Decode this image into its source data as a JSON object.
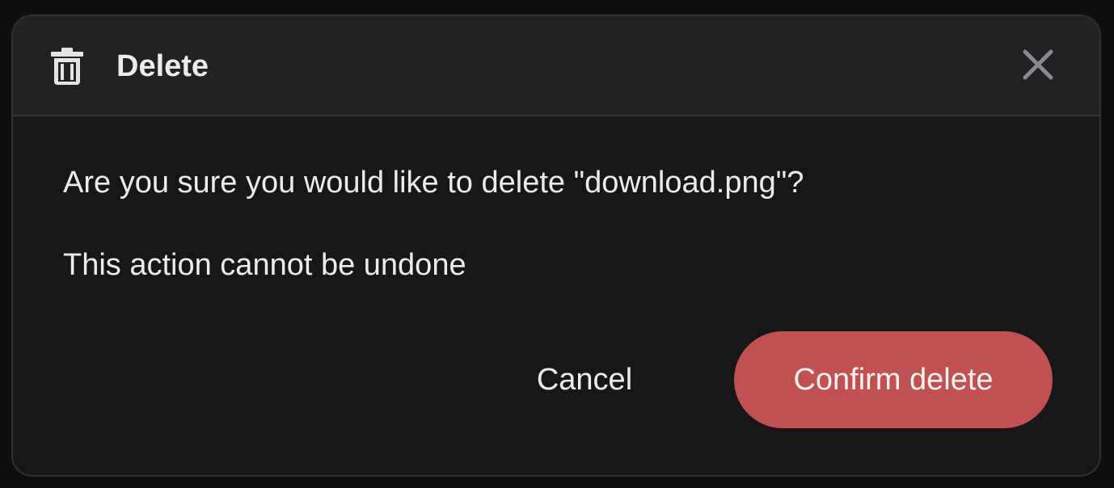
{
  "dialog": {
    "title": "Delete",
    "title_icon": "trash-icon",
    "close_icon": "close-icon",
    "question": "Are you sure you would like to delete \"download.png\"?",
    "warning": "This action cannot be undone",
    "cancel_label": "Cancel",
    "confirm_label": "Confirm delete"
  },
  "colors": {
    "background": "#0f0f10",
    "dialog_bg": "#17171a",
    "header_bg": "#222225",
    "text": "#ececee",
    "danger": "#c05150"
  }
}
